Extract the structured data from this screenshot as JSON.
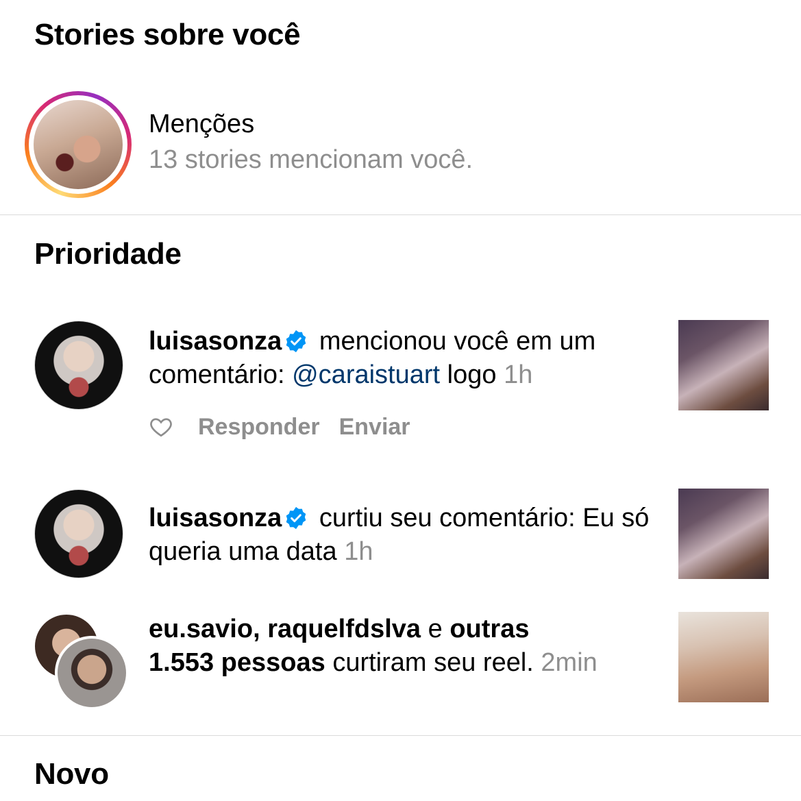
{
  "stories_section": {
    "title": "Stories sobre você",
    "mentions_title": "Menções",
    "mentions_subtitle": "13 stories mencionam você."
  },
  "priority_section": {
    "title": "Prioridade",
    "notifications": [
      {
        "username": "luisasonza",
        "verified": true,
        "text_before": "mencionou você em um comentário:",
        "mention": "@caraistuart",
        "comment": "logo",
        "time": "1h",
        "actions": {
          "like_icon": "heart-outline-icon",
          "reply": "Responder",
          "send": "Enviar"
        }
      },
      {
        "username": "luisasonza",
        "verified": true,
        "text_before": "curtiu seu comentário:",
        "comment": "Eu só queria uma data",
        "time": "1h"
      },
      {
        "user1": "eu.savio",
        "separator": ",",
        "user2": "raquelfdslva",
        "connector": "e",
        "others": "outras 1.553 pessoas",
        "text_after": "curtiram seu reel.",
        "time": "2min"
      }
    ]
  },
  "new_section": {
    "title": "Novo"
  },
  "colors": {
    "muted": "#8e8e8e",
    "link": "#00376b",
    "verified": "#0095f6",
    "divider": "#dbdbdb"
  }
}
